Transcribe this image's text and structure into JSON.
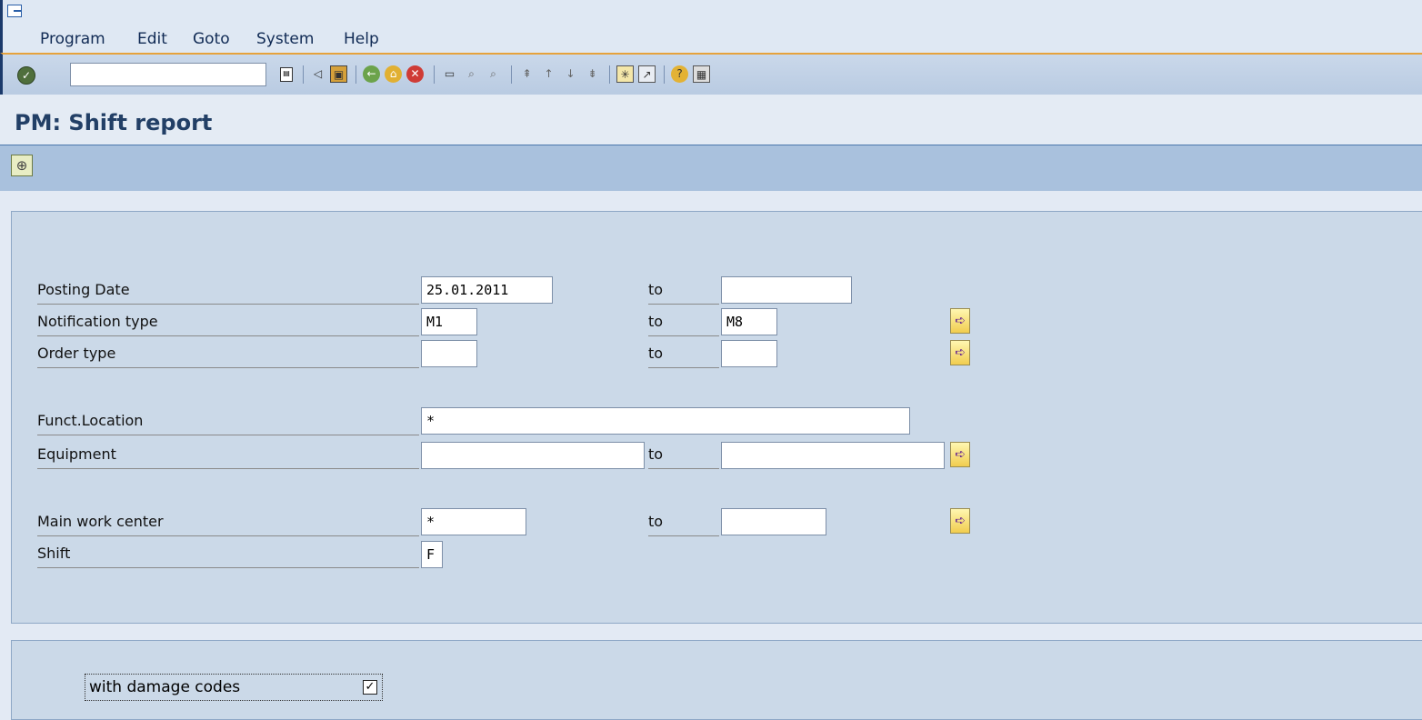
{
  "menu": {
    "items": [
      "Program",
      "Edit",
      "Goto",
      "System",
      "Help"
    ]
  },
  "toolbar": {
    "command_value": "",
    "icons": [
      "enter-icon",
      "command-history-icon",
      "back-arrow-icon",
      "save-icon",
      "back-icon",
      "exit-icon",
      "cancel-icon",
      "print-icon",
      "find-icon",
      "find-next-icon",
      "first-page-icon",
      "previous-page-icon",
      "next-page-icon",
      "last-page-icon",
      "create-session-icon",
      "shortcut-icon",
      "help-icon",
      "layout-icon"
    ]
  },
  "title": "PM: Shift report",
  "form": {
    "to": "to",
    "rows": [
      {
        "label": "Posting Date",
        "from": "25.01.2011",
        "to": ""
      },
      {
        "label": "Notification type",
        "from": "M1",
        "to": "M8"
      },
      {
        "label": "Order type",
        "from": "",
        "to": ""
      },
      {
        "label": "Funct.Location",
        "from": "*"
      },
      {
        "label": "Equipment",
        "from": "",
        "to": ""
      },
      {
        "label": "Main work center",
        "from": "*",
        "to": ""
      },
      {
        "label": "Shift",
        "from": "F"
      }
    ]
  },
  "options": {
    "with_damage_codes_label": "with damage codes",
    "with_damage_codes_checked": "✓"
  },
  "colors": {
    "accent_orange": "#e6a23c",
    "toolbar_blue": "#a9c1dd",
    "title_blue": "#223f66"
  }
}
